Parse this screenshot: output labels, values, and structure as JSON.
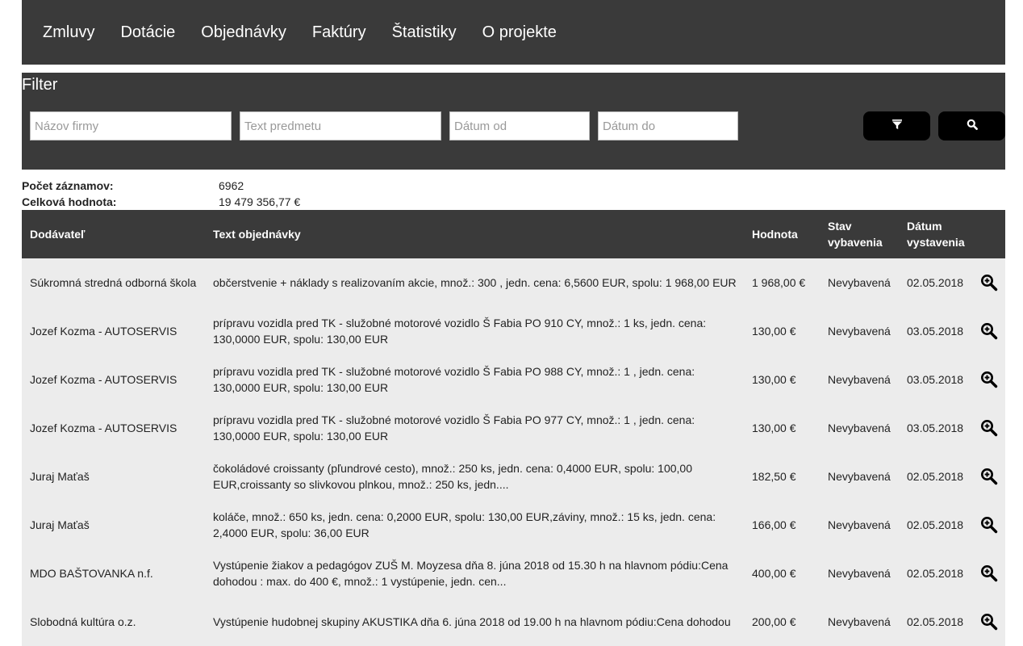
{
  "nav": {
    "items": [
      {
        "label": "Zmluvy"
      },
      {
        "label": "Dotácie"
      },
      {
        "label": "Objednávky"
      },
      {
        "label": "Faktúry"
      },
      {
        "label": "Štatistiky"
      },
      {
        "label": "O projekte"
      }
    ]
  },
  "filter": {
    "title": "Filter",
    "company_placeholder": "Názov firmy",
    "subject_placeholder": "Text predmetu",
    "date_from_placeholder": "Dátum od",
    "date_to_placeholder": "Dátum do",
    "filter_icon": "filter-icon",
    "search_icon": "search-icon"
  },
  "summary": {
    "count_label": "Počet záznamov:",
    "count_value": "6962",
    "total_label": "Celková hodnota:",
    "total_value": "19 479 356,77 €"
  },
  "table": {
    "headers": {
      "supplier": "Dodávateľ",
      "text": "Text objednávky",
      "value": "Hodnota",
      "state_line1": "Stav",
      "state_line2": "vybavenia",
      "date_line1": "Dátum",
      "date_line2": "vystavenia"
    },
    "rows": [
      {
        "supplier": "Súkromná stredná odborná škola",
        "text": "občerstvenie + náklady s realizovaním akcie, množ.: 300 , jedn. cena: 6,5600 EUR, spolu: 1 968,00 EUR",
        "value": "1 968,00 €",
        "state": "Nevybavená",
        "date": "02.05.2018"
      },
      {
        "supplier": "Jozef Kozma - AUTOSERVIS",
        "text": "prípravu vozidla pred TK - služobné motorové vozidlo Š Fabia PO 910 CY, množ.: 1 ks, jedn. cena: 130,0000 EUR, spolu: 130,00 EUR",
        "value": "130,00 €",
        "state": "Nevybavená",
        "date": "03.05.2018"
      },
      {
        "supplier": "Jozef Kozma - AUTOSERVIS",
        "text": "prípravu vozidla pred TK - služobné motorové vozidlo Š Fabia PO 988 CY, množ.: 1 , jedn. cena: 130,0000 EUR, spolu: 130,00 EUR",
        "value": "130,00 €",
        "state": "Nevybavená",
        "date": "03.05.2018"
      },
      {
        "supplier": "Jozef Kozma - AUTOSERVIS",
        "text": "prípravu vozidla pred TK - služobné motorové vozidlo Š Fabia PO 977 CY, množ.: 1 , jedn. cena: 130,0000 EUR, spolu: 130,00 EUR",
        "value": "130,00 €",
        "state": "Nevybavená",
        "date": "03.05.2018"
      },
      {
        "supplier": "Juraj Maťaš",
        "text": "čokoládové croissanty (pľundrové cesto), množ.: 250 ks, jedn. cena: 0,4000 EUR, spolu: 100,00 EUR,croissanty so slivkovou plnkou, množ.: 250 ks, jedn....",
        "value": "182,50 €",
        "state": "Nevybavená",
        "date": "02.05.2018"
      },
      {
        "supplier": "Juraj Maťaš",
        "text": "koláče, množ.: 650 ks, jedn. cena: 0,2000 EUR, spolu: 130,00 EUR,záviny, množ.: 15 ks, jedn. cena: 2,4000 EUR, spolu: 36,00 EUR",
        "value": "166,00 €",
        "state": "Nevybavená",
        "date": "02.05.2018"
      },
      {
        "supplier": "MDO BAŠTOVANKA n.f.",
        "text": "Vystúpenie žiakov a pedagógov ZUŠ M. Moyzesa dňa 8. júna 2018 od 15.30 h na hlavnom pódiu:Cena dohodou : max. do 400 €, množ.: 1 vystúpenie, jedn. cen...",
        "value": "400,00 €",
        "state": "Nevybavená",
        "date": "02.05.2018"
      },
      {
        "supplier": "Slobodná kultúra o.z.",
        "text": "Vystúpenie hudobnej skupiny AKUSTIKA dňa 6. júna 2018 od 19.00 h na hlavnom pódiu:Cena dohodou",
        "value": "200,00 €",
        "state": "Nevybavená",
        "date": "02.05.2018"
      }
    ],
    "detail_icon": "zoom-in-icon"
  }
}
